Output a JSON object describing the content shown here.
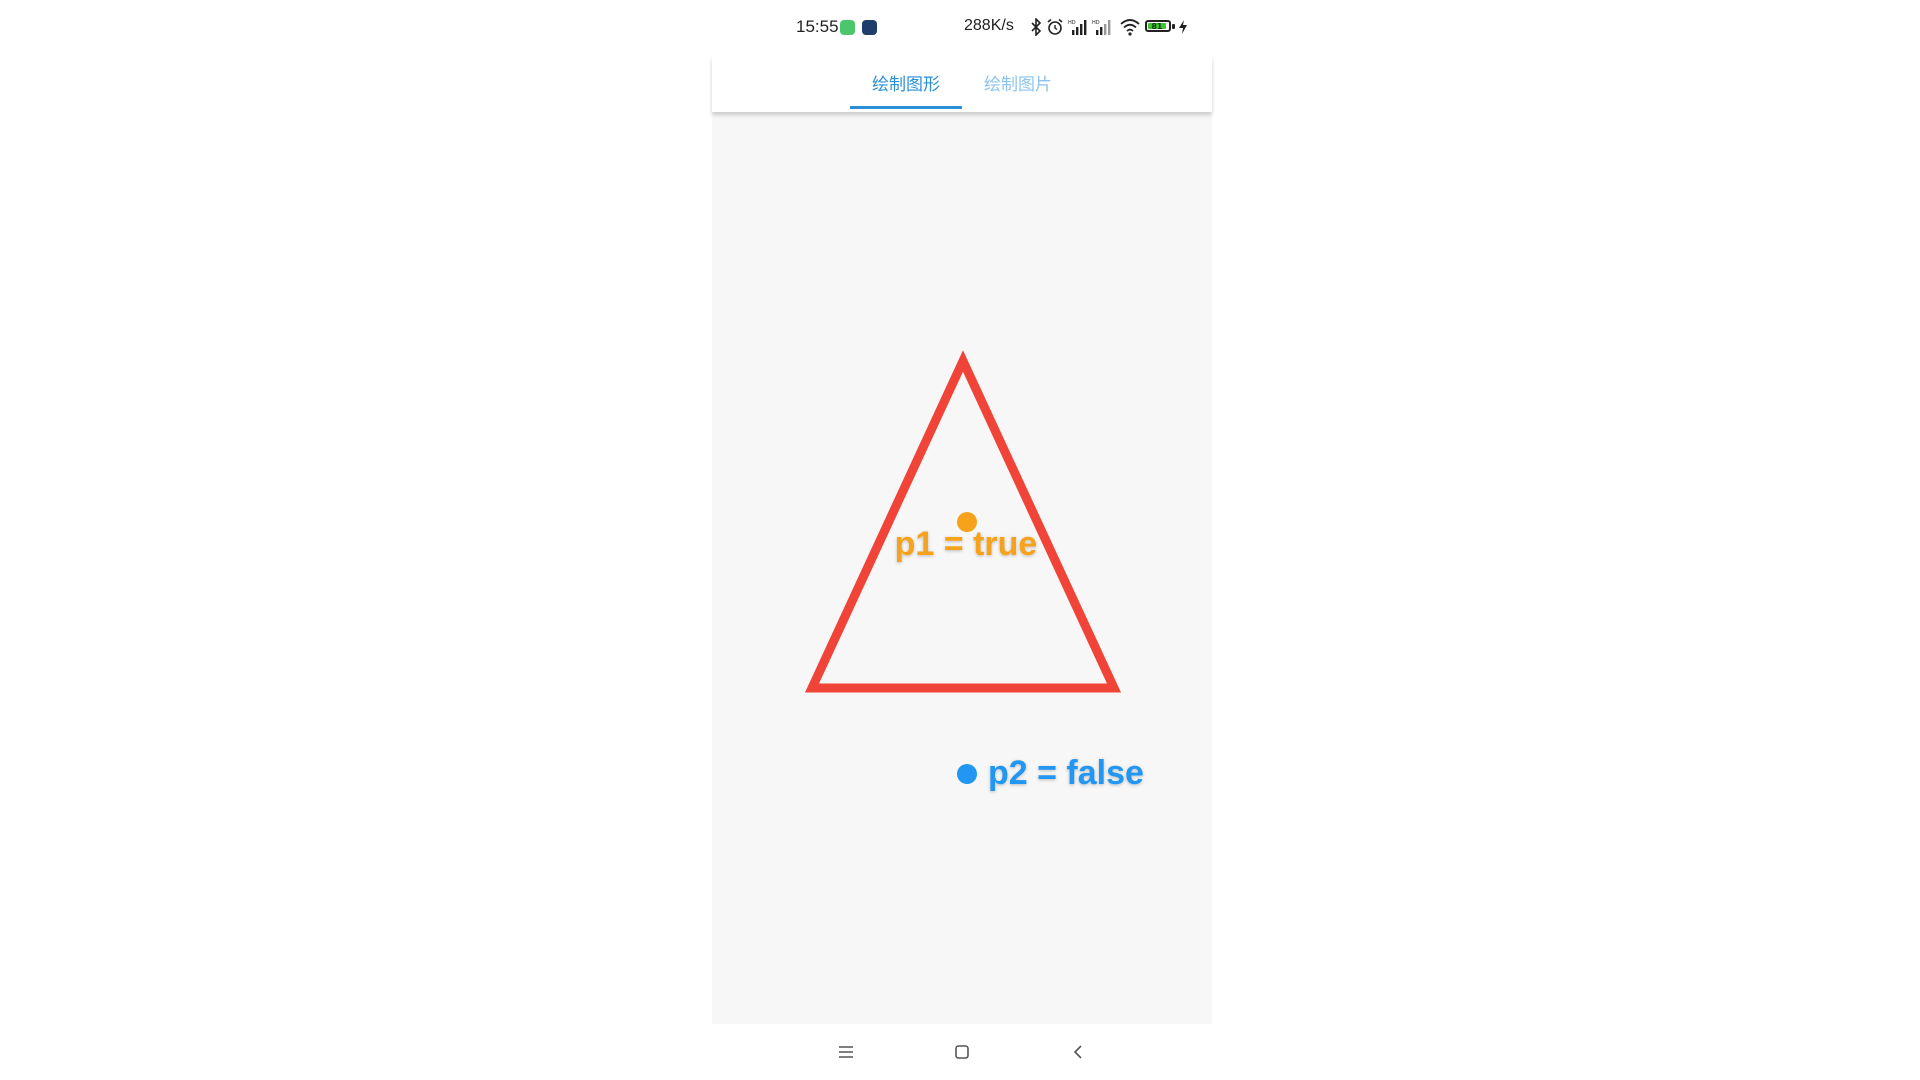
{
  "status_bar": {
    "time": "15:55",
    "network_speed": "288K/s",
    "battery_level": "81",
    "icons": [
      "app-green-icon",
      "app-dark-icon",
      "bluetooth-icon",
      "alarm-icon",
      "signal-hd-icon",
      "signal-hd-icon",
      "wifi-icon",
      "battery-icon",
      "charging-icon"
    ]
  },
  "tabs": [
    {
      "label": "绘制图形",
      "active": true
    },
    {
      "label": "绘制图片",
      "active": false
    }
  ],
  "canvas": {
    "triangle_color": "#f04438",
    "points": [
      {
        "label": "p1 = true",
        "color": "#f7a21b"
      },
      {
        "label": "p2 = false",
        "color": "#2196f3"
      }
    ]
  },
  "nav_bar": {
    "icons": [
      "menu-icon",
      "home-icon",
      "back-icon"
    ]
  }
}
